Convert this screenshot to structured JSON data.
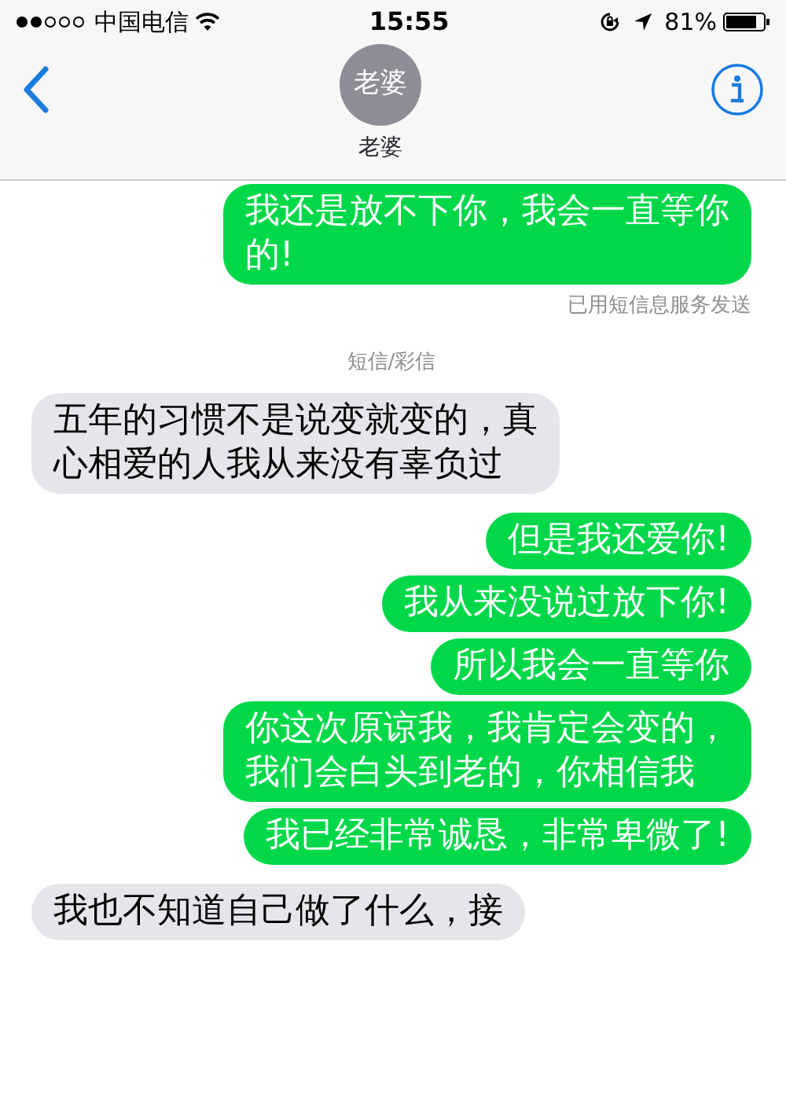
{
  "status_bar": {
    "carrier": "中国电信",
    "time": "15:55",
    "battery": "81%"
  },
  "header": {
    "avatar_text": "老婆",
    "contact_name": "老婆"
  },
  "messages": [
    {
      "kind": "sent",
      "text": "我还是放不下你，我会一直等你的!"
    },
    {
      "kind": "note",
      "text": "已用短信息服务发送"
    },
    {
      "kind": "divider",
      "text": "短信/彩信"
    },
    {
      "kind": "received",
      "text": "五年的习惯不是说变就变的，真心相爱的人我从来没有辜负过"
    },
    {
      "kind": "sent",
      "text": "但是我还爱你!"
    },
    {
      "kind": "sent",
      "text": "我从来没说过放下你!"
    },
    {
      "kind": "sent",
      "text": "所以我会一直等你"
    },
    {
      "kind": "sent",
      "text": "你这次原谅我，我肯定会变的，我们会白头到老的，你相信我"
    },
    {
      "kind": "sent",
      "text": "我已经非常诚恳，非常卑微了!"
    },
    {
      "kind": "received",
      "text": "我也不知道自己做了什么，接"
    }
  ]
}
